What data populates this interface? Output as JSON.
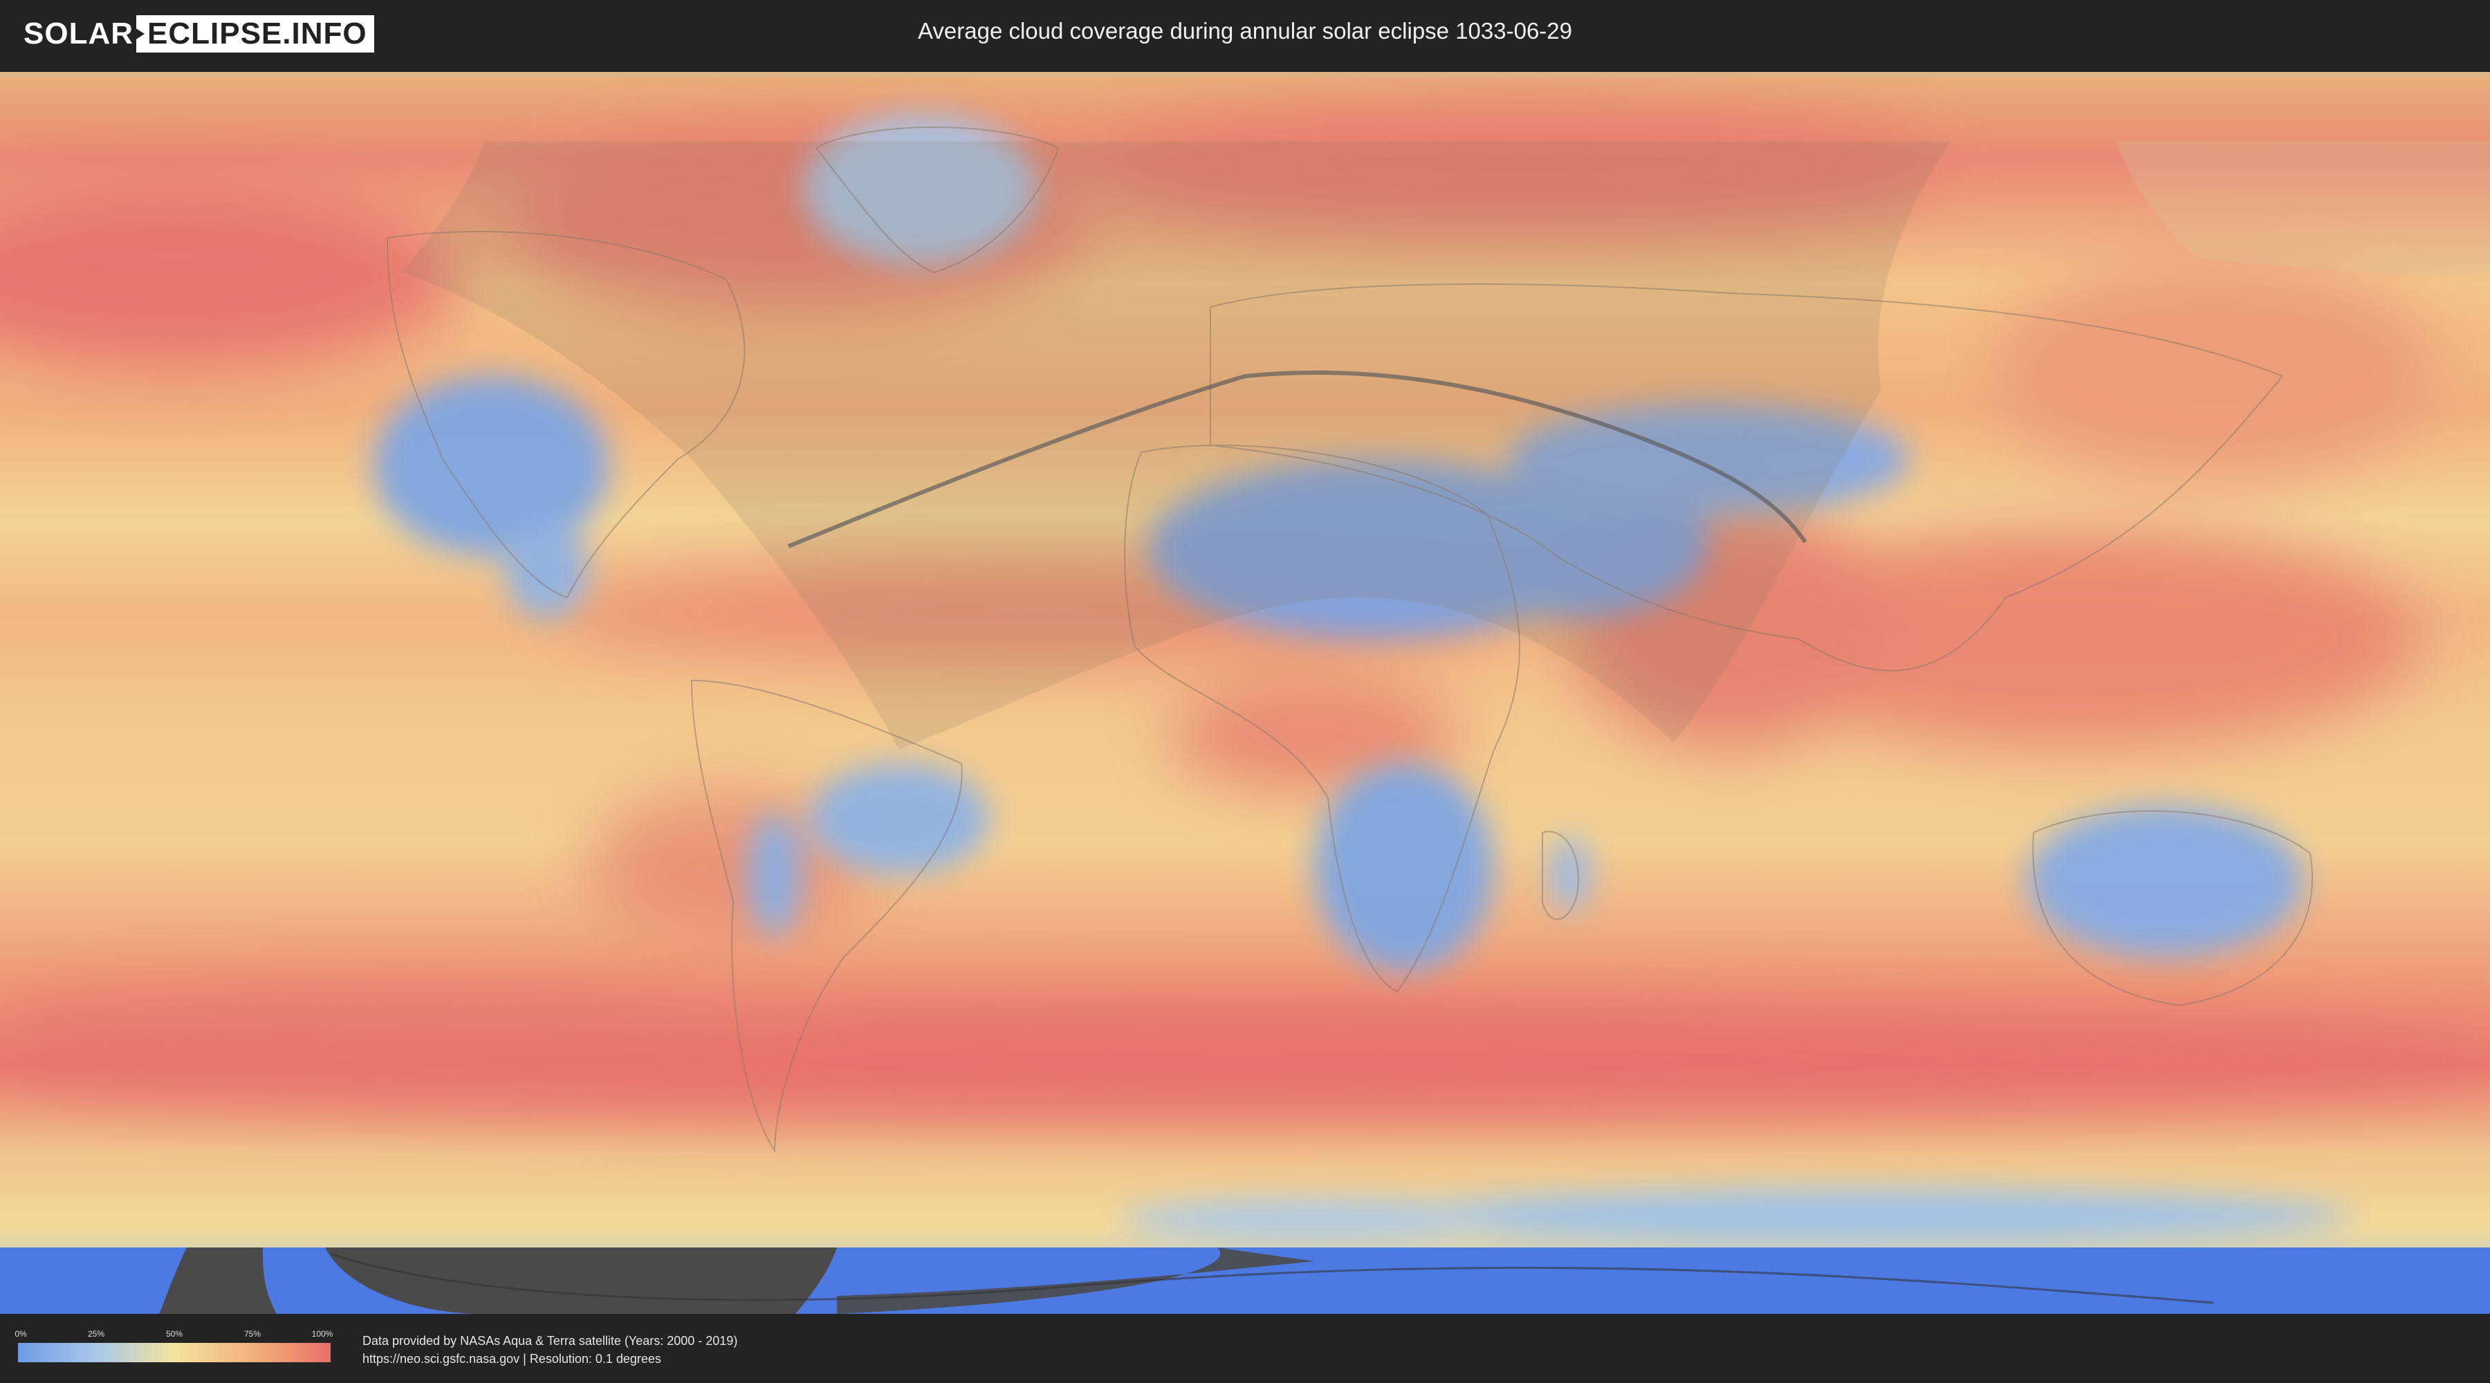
{
  "header": {
    "logo_left": "SOLAR",
    "logo_right": "ECLIPSE.INFO",
    "title": "Average cloud coverage during annular solar eclipse 1033-06-29"
  },
  "legend": {
    "ticks": [
      "0%",
      "25%",
      "50%",
      "75%",
      "100%"
    ],
    "colors": [
      "#6d9be6",
      "#a9c8e8",
      "#f4e39d",
      "#f3b27a",
      "#ea6f6a"
    ]
  },
  "footer": {
    "line1": "Data provided by NASAs Aqua & Terra satellite (Years: 2000 - 2019)",
    "line2": "https://neo.sci.gsfc.nasa.gov | Resolution: 0.1 degrees"
  }
}
